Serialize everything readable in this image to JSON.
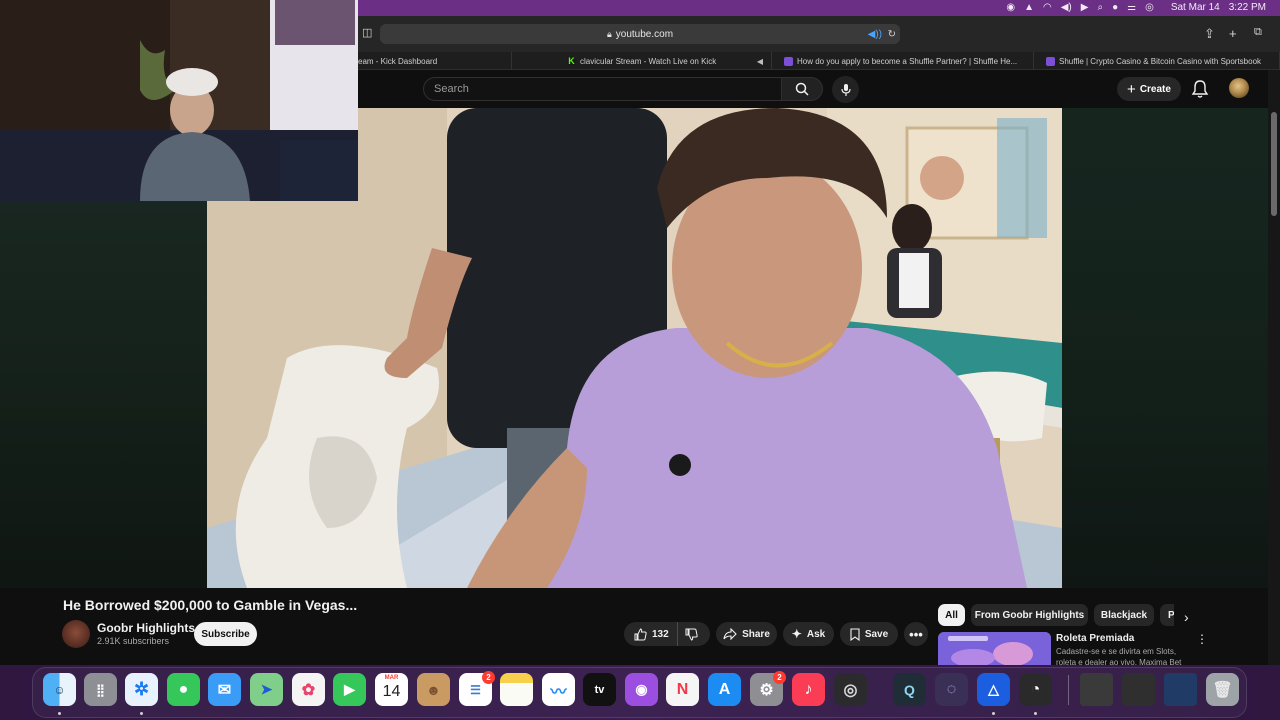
{
  "menubar": {
    "date": "Sat Mar 14",
    "time": "3:22 PM"
  },
  "browser": {
    "url": "youtube.com",
    "tabs": [
      {
        "label": "eam - Kick Dashboard"
      },
      {
        "label": "clavicular Stream - Watch Live on Kick"
      },
      {
        "label": "How do you apply to become a Shuffle Partner? | Shuffle He..."
      },
      {
        "label": "Shuffle | Crypto Casino & Bitcoin Casino with Sportsbook"
      }
    ]
  },
  "youtube": {
    "search_placeholder": "Search",
    "create_label": "Create"
  },
  "video": {
    "title": "He Borrowed $200,000 to Gamble in Vegas...",
    "channel": "Goobr Highlights",
    "subscribers": "2.91K subscribers",
    "subscribe_label": "Subscribe",
    "like_count": "132",
    "share_label": "Share",
    "ask_label": "Ask",
    "save_label": "Save"
  },
  "recommendations": {
    "chips": [
      "All",
      "From Goobr Highlights",
      "Blackjack",
      "Poker"
    ],
    "items": [
      {
        "title": "Roleta Premiada",
        "subtitle": "Cadastre-se e se divirta em Slots, roleta e dealer ao vivo. Maxima Bet"
      }
    ]
  },
  "dock": {
    "calendar_month": "MAR",
    "calendar_day": "14",
    "reminders_badge": "2",
    "settings_badge": "2",
    "tv_label": "tv"
  },
  "colors": {
    "menubar": "#6b2f86",
    "youtube_bg": "#0f0f0f",
    "accent_blue": "#4aa3ff",
    "badge_red": "#ff3b30"
  }
}
